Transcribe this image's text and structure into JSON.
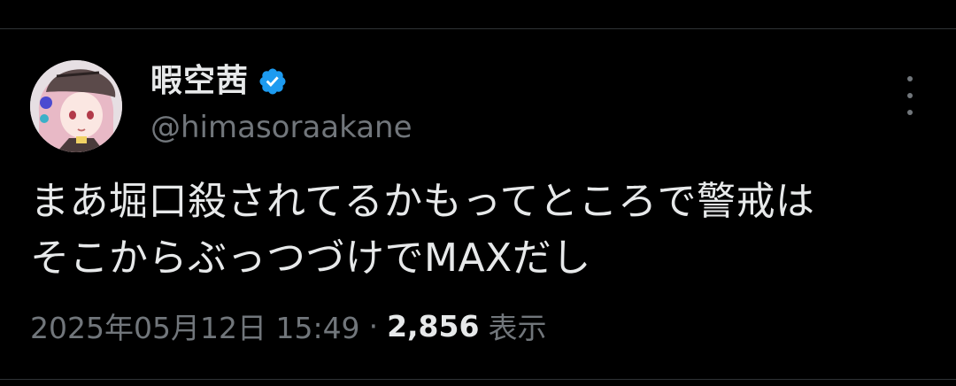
{
  "user": {
    "display_name": "暇空茜",
    "handle": "@himasoraakane",
    "verified": true,
    "verified_color": "#1d9bf0"
  },
  "tweet": {
    "text": "まあ堀口殺されてるかもってところで警戒は\nそこからぶっつづけでMAXだし",
    "timestamp": "2025年05月12日 15:49",
    "separator": "·",
    "views_count": "2,856",
    "views_label": "表示"
  },
  "icons": {
    "verified": "verified-badge-icon",
    "more": "more-options-icon"
  },
  "colors": {
    "background": "#000000",
    "primary_text": "#e7e9ea",
    "secondary_text": "#71767b"
  }
}
